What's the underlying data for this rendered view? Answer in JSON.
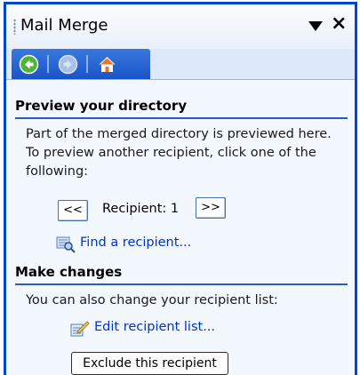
{
  "pane": {
    "title": "Mail Merge",
    "menu_icon": "dropdown-arrow-icon",
    "close_icon": "close-x-icon",
    "nav": [
      {
        "icon": "back-arrow-icon",
        "enabled": true
      },
      {
        "icon": "forward-arrow-icon",
        "enabled": false
      },
      {
        "icon": "home-icon",
        "enabled": true
      }
    ]
  },
  "preview": {
    "heading": "Preview your directory",
    "description": "Part of the merged directory is previewed here. To preview another recipient, click one of the following:",
    "prev_label": "<<",
    "next_label": ">>",
    "recipient_label": "Recipient: 1",
    "find_link": "Find a recipient..."
  },
  "changes": {
    "heading": "Make changes",
    "description": "You can also change your recipient list:",
    "edit_link": "Edit recipient list...",
    "exclude_button": "Exclude this recipient"
  },
  "colors": {
    "frame": "#0046d5",
    "nav_bar": "#1954c6",
    "link": "#0033cc",
    "section_rule": "#2b59c3"
  }
}
